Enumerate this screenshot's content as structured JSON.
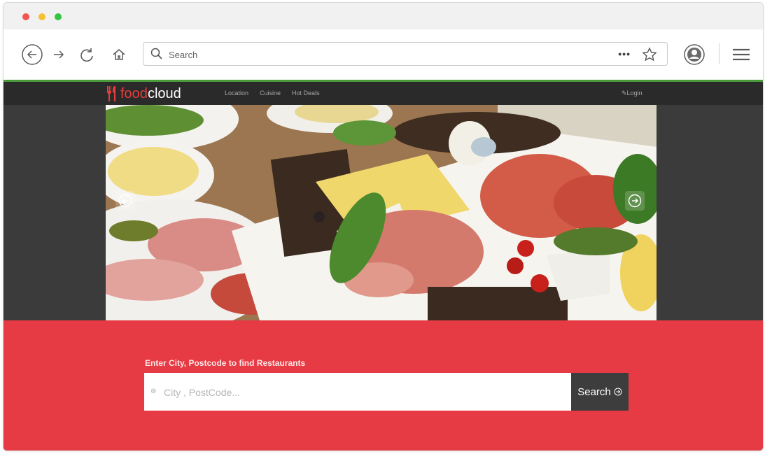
{
  "browser": {
    "url_placeholder": "Search",
    "more_label": "•••"
  },
  "site": {
    "logo_food": "food",
    "logo_cloud": "cloud",
    "nav": [
      "Location",
      "Cuisine",
      "Hot Deals"
    ],
    "login_label": "Login"
  },
  "search": {
    "label": "Enter City, Postcode to find Restaurants",
    "placeholder": "City , PostCode...",
    "button_label": "Search"
  },
  "colors": {
    "accent_red": "#e63b44",
    "nav_bar": "#2a2a2a",
    "browser_border": "#4a9a3a"
  },
  "icons": [
    "back-icon",
    "forward-icon",
    "reload-icon",
    "home-icon",
    "search-icon",
    "star-icon",
    "account-icon",
    "menu-icon",
    "location-pin-icon",
    "arrow-circle-icon"
  ]
}
